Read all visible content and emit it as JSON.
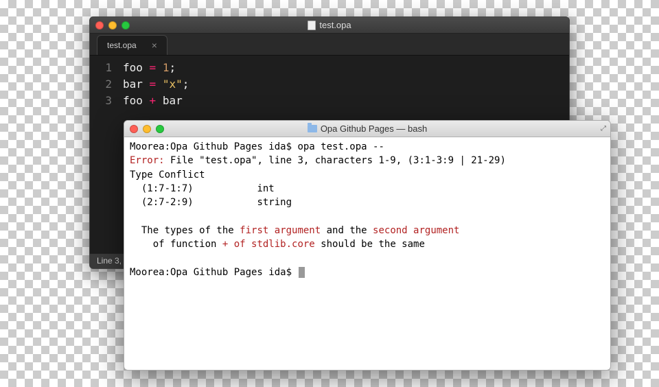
{
  "editor": {
    "window_title": "test.opa",
    "tab": {
      "label": "test.opa",
      "close": "×"
    },
    "gutter": [
      "1",
      "2",
      "3"
    ],
    "code": {
      "l1": {
        "ident": "foo",
        "op": "=",
        "num": "1",
        "semi": ";"
      },
      "l2": {
        "ident": "bar",
        "op": "=",
        "str": "\"x\"",
        "semi": ";"
      },
      "l3": {
        "ident1": "foo",
        "op": "+",
        "ident2": "bar"
      }
    },
    "statusbar": "Line 3,"
  },
  "terminal": {
    "window_title": "Opa Github Pages — bash",
    "prompt1": "Moorea:Opa Github Pages ida$ ",
    "cmd1": "opa test.opa --",
    "error_label": "Error:",
    "error_rest": " File \"test.opa\", line 3, characters 1-9, (3:1-3:9 | 21-29)",
    "conflict_header": "Type Conflict",
    "row1_range": "  (1:7-1:7)           ",
    "row1_type": "int",
    "row2_range": "  (2:7-2:9)           ",
    "row2_type": "string",
    "msg1_a": "  The types of the ",
    "msg1_first": "first argument",
    "msg1_b": " and the ",
    "msg1_second": "second argument",
    "msg2_a": "    of function ",
    "msg2_plus": "+",
    "msg2_b": " ",
    "msg2_of": "of stdlib.core",
    "msg2_c": " should be the same",
    "prompt2": "Moorea:Opa Github Pages ida$ "
  }
}
